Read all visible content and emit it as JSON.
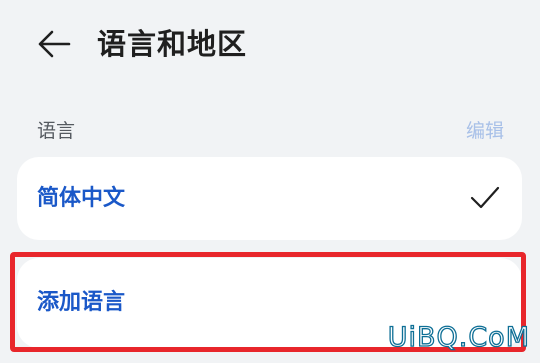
{
  "header": {
    "title": "语言和地区"
  },
  "language_section": {
    "label": "语言",
    "edit_label": "编辑",
    "languages": [
      {
        "label": "简体中文",
        "selected": true
      }
    ],
    "add_label": "添加语言"
  },
  "colors": {
    "accent": "#1a58c8",
    "edit_disabled": "#a8c0e8",
    "highlight": "#e8262b",
    "background": "#f1f3f5"
  },
  "watermark": {
    "text": "UiBQ.CoM"
  }
}
